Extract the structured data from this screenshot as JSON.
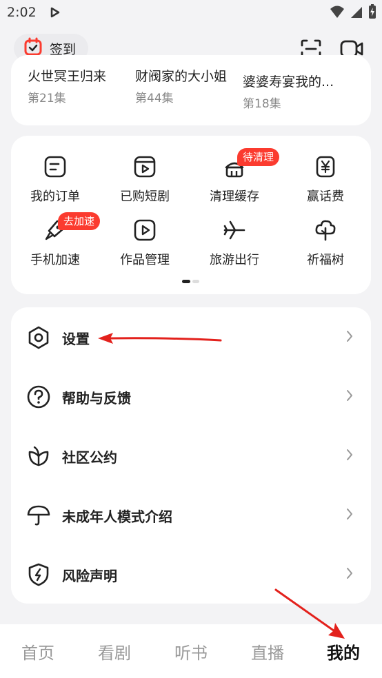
{
  "status_bar": {
    "time": "2:02"
  },
  "top_bar": {
    "checkin_label": "签到"
  },
  "recent_dramas": [
    {
      "title": "火世冥王归来",
      "episode": "第21集"
    },
    {
      "title": "财阀家的大小姐",
      "episode": "第44集"
    },
    {
      "title": "婆婆寿宴我的...",
      "episode": "第18集"
    }
  ],
  "grid": {
    "items": [
      {
        "label": "我的订单",
        "icon": "order-icon"
      },
      {
        "label": "已购短剧",
        "icon": "purchased-drama-icon"
      },
      {
        "label": "清理缓存",
        "icon": "clear-cache-icon"
      },
      {
        "label": "赢话费",
        "icon": "yen-icon"
      },
      {
        "label": "手机加速",
        "icon": "rocket-icon"
      },
      {
        "label": "作品管理",
        "icon": "works-icon"
      },
      {
        "label": "旅游出行",
        "icon": "plane-icon"
      },
      {
        "label": "祈福树",
        "icon": "tree-icon"
      }
    ],
    "badge_cache": "待清理",
    "badge_speed": "去加速",
    "accent_color": "#fb3b2f"
  },
  "menu": {
    "items": [
      {
        "label": "设置",
        "icon": "settings-icon"
      },
      {
        "label": "帮助与反馈",
        "icon": "help-icon"
      },
      {
        "label": "社区公约",
        "icon": "leaf-icon"
      },
      {
        "label": "未成年人模式介绍",
        "icon": "umbrella-icon"
      },
      {
        "label": "风险声明",
        "icon": "shield-icon"
      }
    ]
  },
  "bottom_nav": {
    "items": [
      "首页",
      "看剧",
      "听书",
      "直播",
      "我的"
    ],
    "active": "我的"
  },
  "annotation_color": "#e3211c"
}
